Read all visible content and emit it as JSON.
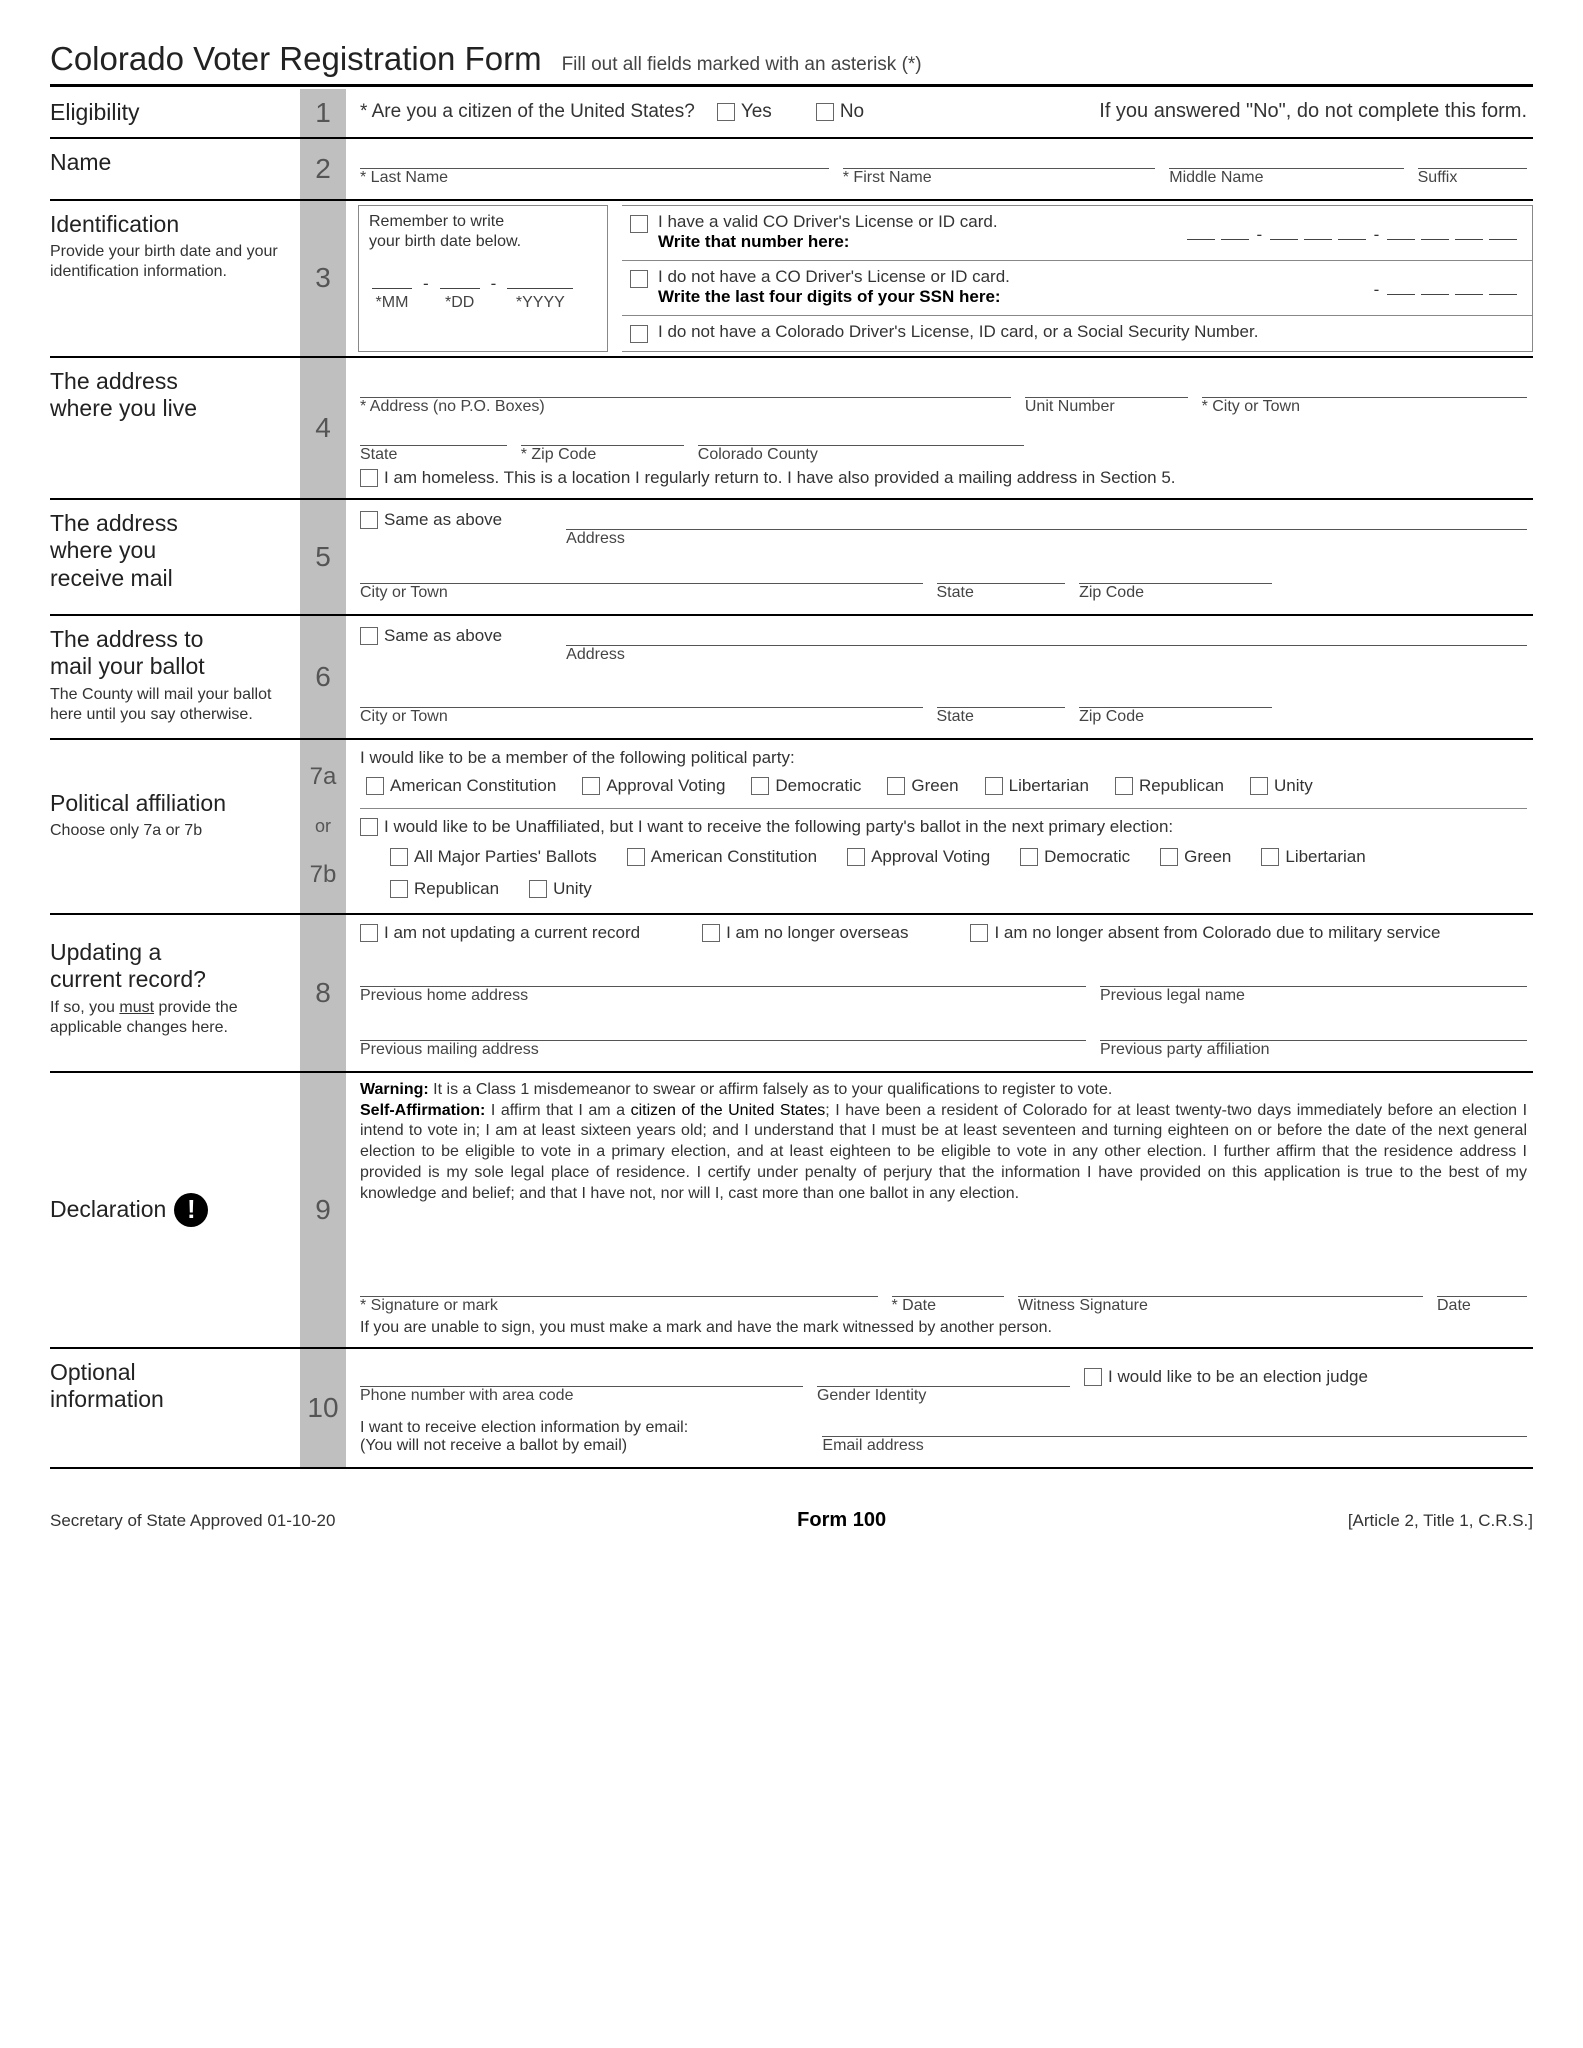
{
  "title": "Colorado Voter Registration Form",
  "subtitle": "Fill out all fields marked with an asterisk (*)",
  "s1": {
    "label": "Eligibility",
    "q": "*  Are you a citizen of the United States?",
    "yes": "Yes",
    "no": "No",
    "warn": "If you answered \"No\", do not complete this form."
  },
  "s2": {
    "label": "Name",
    "last": "* Last Name",
    "first": "* First Name",
    "middle": "Middle Name",
    "suffix": "Suffix"
  },
  "s3": {
    "label": "Identification",
    "sub": "Provide your birth date and your identification information.",
    "rem1": "Remember to write",
    "rem2": "your birth date below.",
    "mm": "*MM",
    "dd": "*DD",
    "yyyy": "*YYYY",
    "a1": "I have a valid CO Driver's License or ID card.",
    "a1b": "Write that number here:",
    "a2": "I do not have a CO Driver's License or ID card.",
    "a2b": "Write the last four digits of your SSN here:",
    "a3": "I do not have a Colorado Driver's License, ID card, or a Social Security Number."
  },
  "s4": {
    "label1": "The address",
    "label2": "where you live",
    "addr": "* Address (no P.O. Boxes)",
    "unit": "Unit Number",
    "city": "* City or Town",
    "state": "State",
    "zip": "* Zip Code",
    "county": "Colorado County",
    "homeless": "I am homeless. This is a location I regularly return to. I have also provided a mailing address in Section 5."
  },
  "s5": {
    "label1": "The address",
    "label2": "where you",
    "label3": "receive mail",
    "same": "Same as above",
    "addr": "Address",
    "city": "City or Town",
    "state": "State",
    "zip": "Zip Code"
  },
  "s6": {
    "label1": "The address to",
    "label2": "mail your ballot",
    "sub": "The County will mail your ballot here until you say otherwise.",
    "same": "Same as above",
    "addr": "Address",
    "city": "City or Town",
    "state": "State",
    "zip": "Zip Code"
  },
  "s7": {
    "label": "Political affiliation",
    "sub": "Choose only 7a or 7b",
    "intro_a": "I would like to be a member of the following political party:",
    "parties": [
      "American Constitution",
      "Approval Voting",
      "Democratic",
      "Green",
      "Libertarian",
      "Republican",
      "Unity"
    ],
    "or": "or",
    "intro_b": "I would like to be Unaffiliated, but I want to receive the following party's ballot in the next primary election:",
    "ballots": [
      "All Major Parties' Ballots",
      "American Constitution",
      "Approval Voting",
      "Democratic",
      "Green",
      "Libertarian",
      "Republican",
      "Unity"
    ]
  },
  "s8": {
    "label1": "Updating a",
    "label2": "current record?",
    "sub1": "If so, you ",
    "sub2": "must",
    "sub3": " provide the applicable changes here.",
    "c1": "I am not updating a current record",
    "c2": "I am no longer overseas",
    "c3": "I am no longer absent from Colorado due to military service",
    "f1": "Previous home address",
    "f2": "Previous legal name",
    "f3": "Previous mailing address",
    "f4": "Previous party affiliation"
  },
  "s9": {
    "label": "Declaration",
    "warn_h": "Warning:",
    "warn": " It is a Class 1 misdemeanor to swear or affirm falsely as to your qualifications to register to vote.",
    "aff_h": "Self-Affirmation:",
    "aff1": " I affirm that I am a ",
    "b1": "citizen of the United States",
    "aff2": "; I have been a ",
    "b2": "resident of Colorado for at least twenty-two days",
    "aff3": " immediately before an election I intend to vote in; I am at least sixteen years old;  and I understand that I must be at least seventeen and turning eighteen on or before the date of the next general election to be eligible to vote in a primary election, and at least eighteen to be eligible to vote in any other election. I further affirm that the residence address I provided is ",
    "b3": "my sole legal place of residence",
    "aff4": ". I certify under penalty of perjury that the information I have provided on this application is true to the best of my knowledge and belief; and that I have not, nor will I, cast more than one ballot in any election.",
    "sig": "* Signature or mark",
    "date": "* Date",
    "wit": "Witness Signature",
    "wdate": "Date",
    "note": "If you are unable to sign, you must make a mark and have the mark witnessed by another person."
  },
  "s10": {
    "label1": "Optional",
    "label2": "information",
    "phone": "Phone number with area code",
    "gender": "Gender Identity",
    "judge": "I would like to be an election judge",
    "email1": "I want to receive election information by email:",
    "email2": "(You will not receive a ballot by email)",
    "emaillab": "Email address"
  },
  "footer": {
    "left": "Secretary of State Approved 01-10-20",
    "mid": "Form 100",
    "right": "[Article 2, Title 1, C.R.S.]"
  }
}
